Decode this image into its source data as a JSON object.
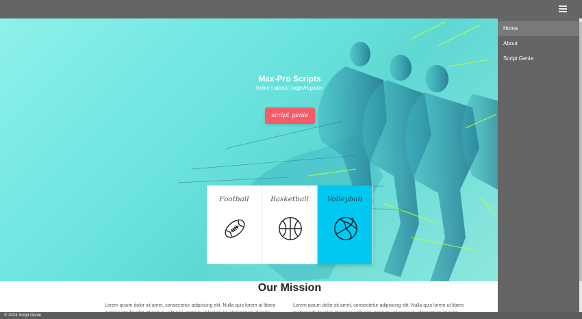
{
  "topbar": {
    "menu_icon": "hamburger-icon"
  },
  "hero": {
    "title": "Max-Pro Scripts",
    "links": [
      "home",
      "about",
      "login",
      "register"
    ],
    "cta_label": "script genie"
  },
  "sports": [
    {
      "label": "Football",
      "icon": "football-icon"
    },
    {
      "label": "Basketball",
      "icon": "basketball-icon"
    },
    {
      "label": "Volleyball",
      "icon": "volleyball-icon"
    }
  ],
  "mission": {
    "title": "Our Mission",
    "col1": "Lorem ipsum dolor sit amet, consectetur adipiscing elit. Nulla quis lorem ut libero malesuada feugiat. Quisque velit nisi, pretium ut lacinia in, elementum id enim.",
    "col2": "Lorem ipsum dolor sit amet, consectetur adipiscing elit. Nulla quis lorem ut libero malesuada feugiat. Quisque velit nisi, pretium ut lacinia in, elementum id enim."
  },
  "sidebar": {
    "items": [
      {
        "label": "Home"
      },
      {
        "label": "About"
      },
      {
        "label": "Script Genie"
      }
    ]
  },
  "footer": {
    "text": "© 2024 Script Genie"
  },
  "colors": {
    "hero": "#6fe6e1",
    "cta": "#f65b6a",
    "active_card": "#00c8f0",
    "sidebar": "#656565"
  }
}
